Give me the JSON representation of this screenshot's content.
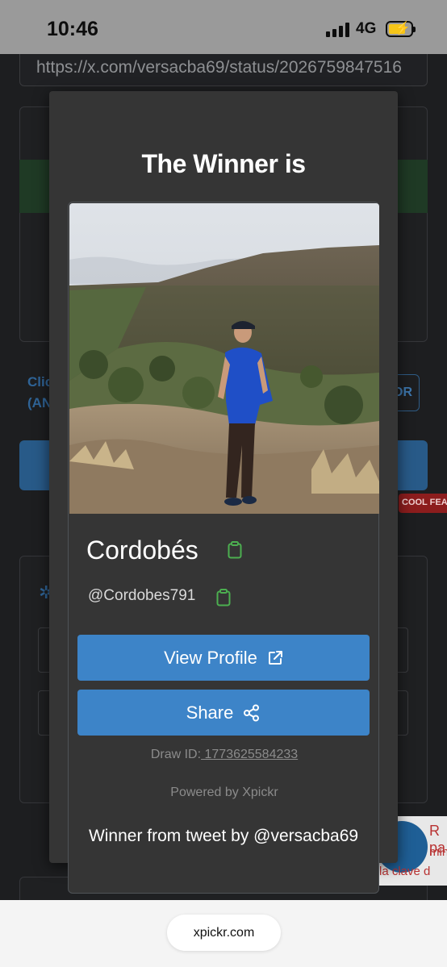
{
  "status_bar": {
    "time": "10:46",
    "network": "4G"
  },
  "background": {
    "url_value": "https://x.com/versacba69/status/2026759847516",
    "clip_text_1": "Clic",
    "clip_text_2": "(AN",
    "outline_button_fragment": "OR",
    "badge_fragment": "COOL FEA",
    "fab_fragment_1": "R pa",
    "fab_fragment_2": "mini",
    "fab_fragment_3": "la clave d"
  },
  "modal": {
    "title": "The Winner is",
    "winner_name": "Cordobés",
    "winner_handle": "@Cordobes791",
    "view_profile_label": "View Profile",
    "share_label": "Share",
    "draw_id_label": "Draw ID:",
    "draw_id_value": " 1773625584233",
    "powered_by": "Powered by Xpickr",
    "winner_from": "Winner from tweet by @versacba69"
  },
  "browser": {
    "url": "xpickr.com"
  },
  "colors": {
    "accent": "#3d84c8",
    "copy_icon": "#4caf50",
    "modal_bg": "#353535"
  }
}
